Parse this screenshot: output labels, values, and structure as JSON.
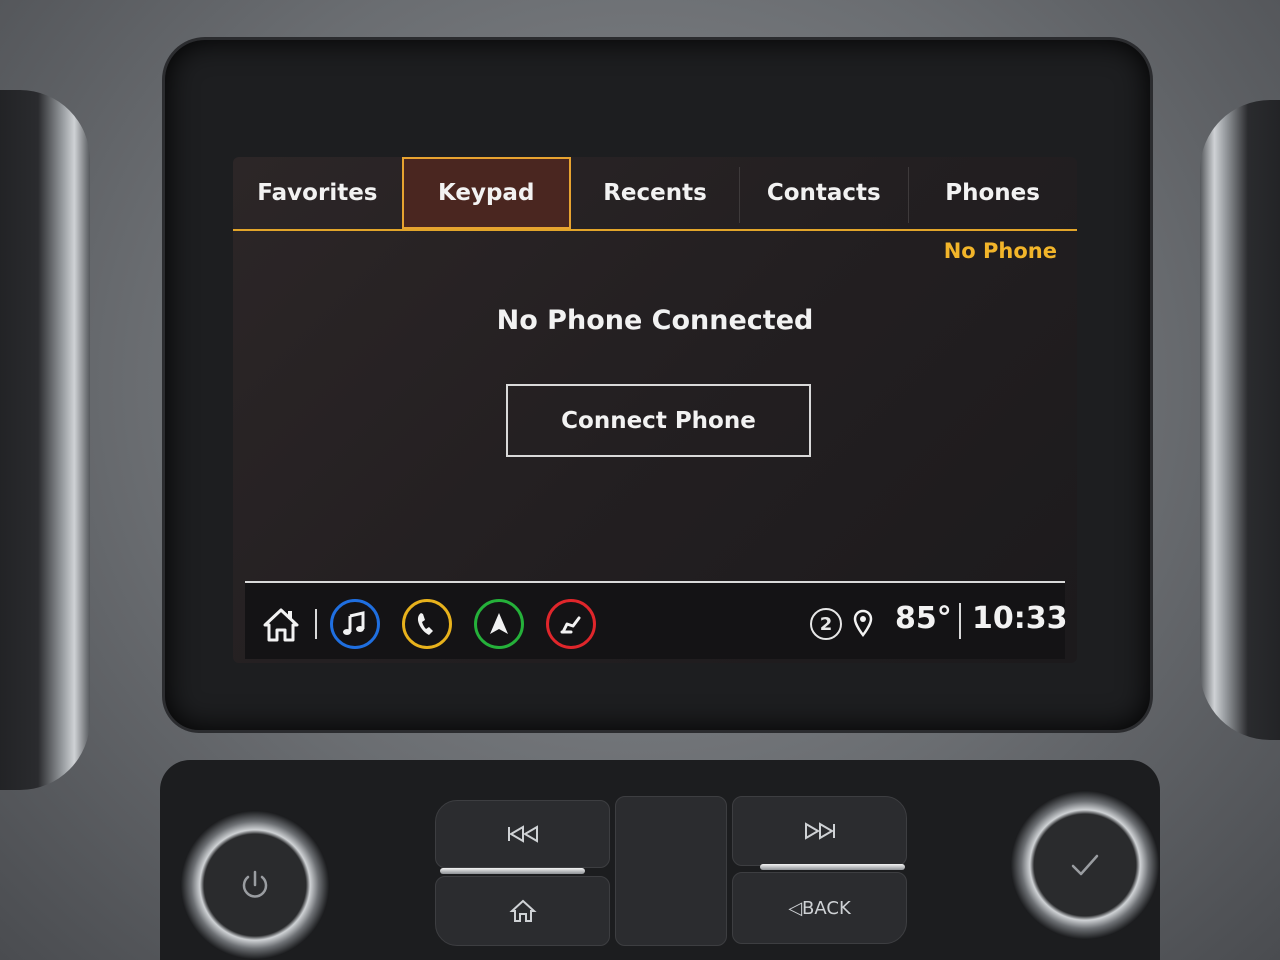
{
  "tabs": [
    {
      "label": "Favorites",
      "active": false
    },
    {
      "label": "Keypad",
      "active": true
    },
    {
      "label": "Recents",
      "active": false
    },
    {
      "label": "Contacts",
      "active": false
    },
    {
      "label": "Phones",
      "active": false
    }
  ],
  "status": {
    "phone_state": "No Phone"
  },
  "main": {
    "message": "No Phone Connected",
    "connect_button": "Connect Phone"
  },
  "bottom_bar": {
    "apps": [
      {
        "name": "home-icon"
      },
      {
        "name": "music-icon",
        "color": "#1f6fe0"
      },
      {
        "name": "phone-icon",
        "color": "#e8b21c"
      },
      {
        "name": "navigation-icon",
        "color": "#25b13a"
      },
      {
        "name": "vehicle-seat-icon",
        "color": "#e0262b"
      }
    ],
    "notification_count": "2",
    "temperature": "85°",
    "time": "10:33"
  },
  "controls": {
    "back_label": "◁BACK"
  },
  "colors": {
    "accent": "#e2a52a",
    "status_text": "#f2b52a",
    "active_tab_bg": "#4a2620"
  }
}
